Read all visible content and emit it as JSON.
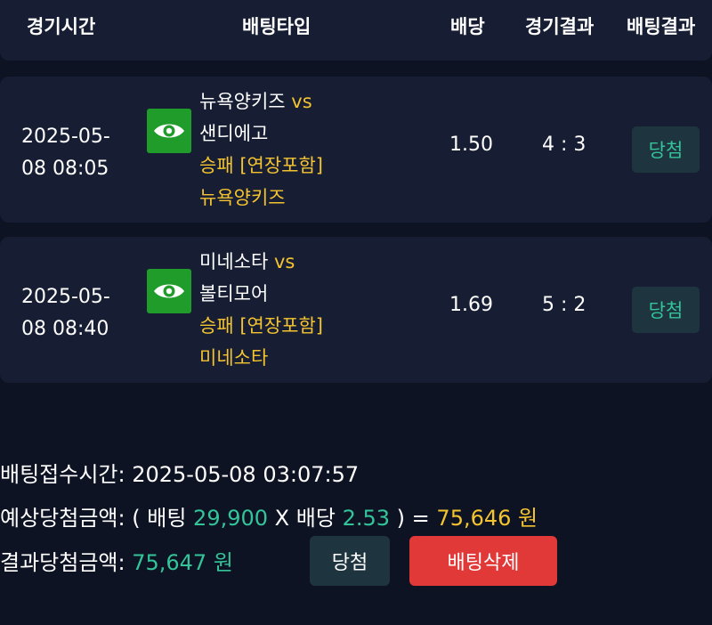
{
  "header": {
    "time": "경기시간",
    "bet_type": "배팅타입",
    "odds": "배당",
    "game_result": "경기결과",
    "bet_result": "배팅결과"
  },
  "bets": [
    {
      "date_line1": "2025-05-",
      "date_line2": "08 08:05",
      "home": "뉴욕양키즈",
      "vs": "vs",
      "away": "샌디에고",
      "market": "승패 [연장포함]",
      "pick": "뉴욕양키즈",
      "odds": "1.50",
      "score": "4 : 3",
      "result": "당첨"
    },
    {
      "date_line1": "2025-05-",
      "date_line2": "08 08:40",
      "home": "미네소타",
      "vs": "vs",
      "away": "볼티모어",
      "market": "승패 [연장포함]",
      "pick": "미네소타",
      "odds": "1.69",
      "score": "5 : 2",
      "result": "당첨"
    }
  ],
  "summary": {
    "received_label": "배팅접수시간:",
    "received_value": "2025-05-08 03:07:57",
    "expected_label": "예상당첨금액:",
    "open_paren": "(",
    "bet_word": "배팅",
    "bet_amount": "29,900",
    "times": "X",
    "odds_word": "배당",
    "total_odds": "2.53",
    "close_paren": ")",
    "equals": "=",
    "expected_amount": "75,646",
    "currency": "원",
    "result_label": "결과당첨금액:",
    "result_amount": "75,647"
  },
  "actions": {
    "status_label": "당첨",
    "delete_label": "배팅삭제"
  },
  "icons": {
    "view": "eye-icon"
  },
  "colors": {
    "background": "#0e1324",
    "card": "#171d33",
    "accent_yellow": "#f4c430",
    "accent_green": "#33c49a",
    "view_button": "#1f9c2a",
    "delete_button": "#e13838"
  }
}
